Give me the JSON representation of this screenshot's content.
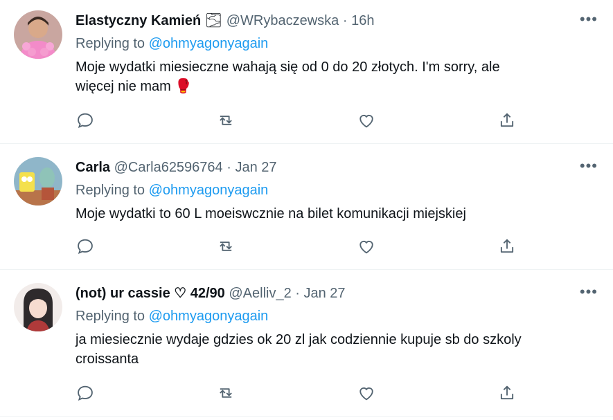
{
  "tweets": [
    {
      "name": "Elastyczny Kamień",
      "name_emoji": "🌫",
      "handle": "@WRybaczewska",
      "sep": "·",
      "time": "16h",
      "replying_label": "Replying to",
      "replying_handle": "@ohmyagonyagain",
      "text_line1": "Moje wydatki miesieczne wahają się od 0 do 20 złotych. I'm sorry, ale",
      "text_line2": "więcej nie mam 🥊"
    },
    {
      "name": "Carla",
      "handle": "@Carla62596764",
      "sep": "·",
      "time": "Jan 27",
      "replying_label": "Replying to",
      "replying_handle": "@ohmyagonyagain",
      "text_line1": "Moje wydatki to 60 L moeiswcznie na bilet komunikacji miejskiej"
    },
    {
      "name": "(not) ur cassie ♡ 42/90",
      "handle": "@Aelliv_2",
      "sep": "·",
      "time": "Jan 27",
      "replying_label": "Replying to",
      "replying_handle": "@ohmyagonyagain",
      "text_line1": "ja miesiecznie wydaje gdzies ok 20 zl jak codziennie kupuje sb do szkoly",
      "text_line2": "croissanta"
    }
  ],
  "more_label": "•••",
  "colors": {
    "link": "#1d9bf0",
    "muted": "#536471",
    "text": "#0f1419",
    "divider": "#eff3f4"
  }
}
